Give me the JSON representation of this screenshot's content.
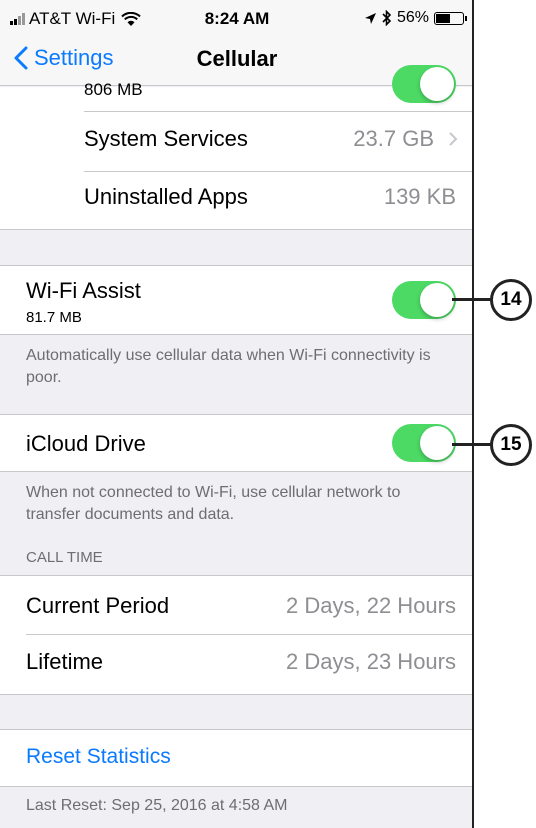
{
  "status_bar": {
    "carrier": "AT&T Wi-Fi",
    "time": "8:24 AM",
    "battery_percent": "56%",
    "battery_level": 0.56,
    "icons": [
      "signal-bars-icon",
      "wifi-icon",
      "location-arrow-icon",
      "bluetooth-icon",
      "battery-icon"
    ]
  },
  "nav": {
    "back_label": "Settings",
    "title": "Cellular"
  },
  "apps": [
    {
      "label": "",
      "value": "806 MB",
      "toggle": true
    },
    {
      "label": "System Services",
      "value": "23.7 GB"
    },
    {
      "label": "Uninstalled Apps",
      "value": "139 KB"
    }
  ],
  "wifi_assist": {
    "label": "Wi-Fi Assist",
    "usage": "81.7 MB",
    "enabled": true,
    "footer": "Automatically use cellular data when Wi-Fi connectivity is poor."
  },
  "icloud_drive": {
    "label": "iCloud Drive",
    "enabled": true,
    "footer": "When not connected to Wi-Fi, use cellular network to transfer documents and data."
  },
  "call_time": {
    "header": "CALL TIME",
    "rows": [
      {
        "label": "Current Period",
        "value": "2 Days, 22 Hours"
      },
      {
        "label": "Lifetime",
        "value": "2 Days, 23 Hours"
      }
    ]
  },
  "reset": {
    "label": "Reset Statistics",
    "last_reset": "Last Reset: Sep 25, 2016 at 4:58 AM"
  },
  "callouts": [
    "14",
    "15"
  ],
  "colors": {
    "accent": "#0a7aff",
    "toggle_on": "#4cd964",
    "background": "#efeff4"
  }
}
